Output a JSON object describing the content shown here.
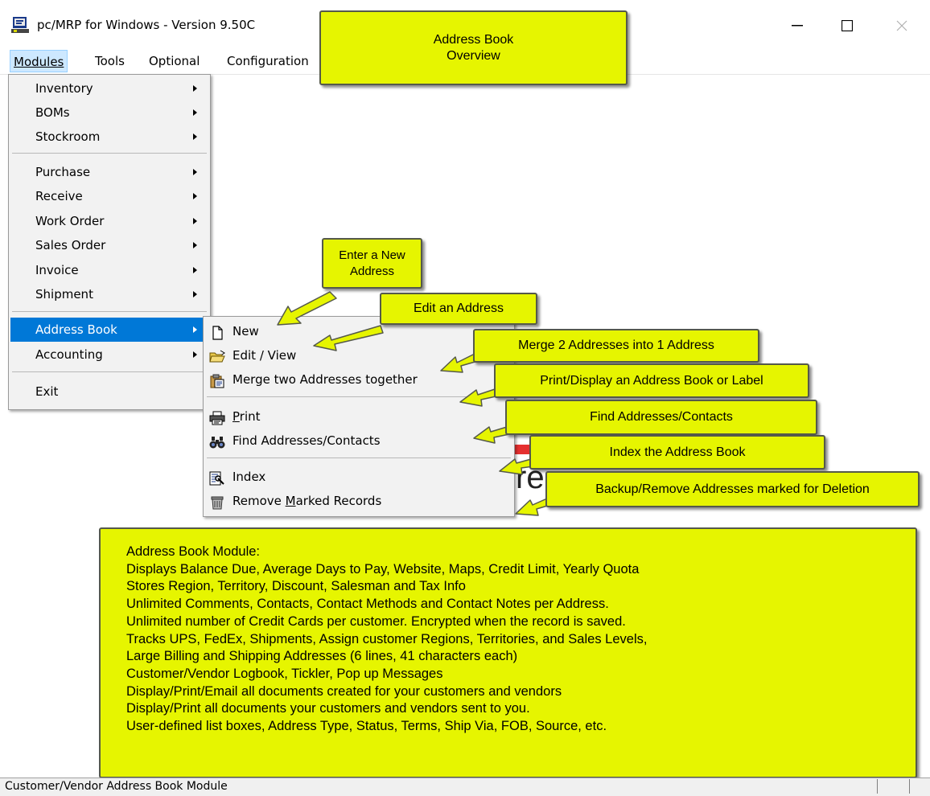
{
  "window": {
    "title": "pc/MRP for Windows - Version 9.50C",
    "controls": [
      "minimize-icon",
      "maximize-icon",
      "close-icon"
    ]
  },
  "menubar": {
    "items": [
      "Modules",
      "Tools",
      "Optional",
      "Configuration"
    ]
  },
  "modules_menu": {
    "inventory": "Inventory",
    "boms": "BOMs",
    "stockroom": "Stockroom",
    "purchase": "Purchase",
    "receive": "Receive",
    "work_order": "Work Order",
    "sales_order": "Sales Order",
    "invoice": "Invoice",
    "shipment": "Shipment",
    "address_book": "Address Book",
    "accounting": "Accounting",
    "exit": "Exit"
  },
  "address_book_menu": {
    "new": "New",
    "edit_view": "Edit / View",
    "merge": "Merge two Addresses together",
    "print": "Print",
    "find": "Find Addresses/Contacts",
    "index": "Index",
    "remove": "Remove Marked Records"
  },
  "callouts": {
    "title_line1": "Address Book",
    "title_line2": "Overview",
    "new_line1": "Enter a New",
    "new_line2": "Address",
    "edit": "Edit an Address",
    "merge": "Merge 2 Addresses into 1 Address",
    "print": "Print/Display an Address Book or Label",
    "find": "Find Addresses/Contacts",
    "index": "Index the Address Book",
    "remove": "Backup/Remove Addresses marked for Deletion"
  },
  "module_summary": {
    "lines": [
      "Address Book Module:",
      "Displays Balance Due, Average Days to Pay, Website, Maps, Credit Limit, Yearly Quota",
      "Stores Region, Territory, Discount, Salesman and Tax Info",
      "Unlimited Comments, Contacts, Contact Methods and Contact Notes per Address.",
      "Unlimited number of Credit Cards per customer.  Encrypted when the record is saved.",
      "Tracks UPS, FedEx, Shipments, Assign customer Regions, Territories, and Sales Levels,",
      "Large Billing and Shipping Addresses (6 lines, 41 characters each)",
      "Customer/Vendor Logbook, Tickler, Pop up Messages",
      "Display/Print/Email all documents created for your customers and vendors",
      "Display/Print all documents your customers and vendors sent to you.",
      "User-defined list boxes, Address Type, Status, Terms, Ship Via, FOB, Source, etc."
    ]
  },
  "background": {
    "partial_text": "re"
  },
  "statusbar": {
    "text": "Customer/Vendor Address Book Module"
  },
  "colors": {
    "callout": "#e6f500",
    "highlight": "#0078d7",
    "menu_bg": "#f2f2f2"
  }
}
